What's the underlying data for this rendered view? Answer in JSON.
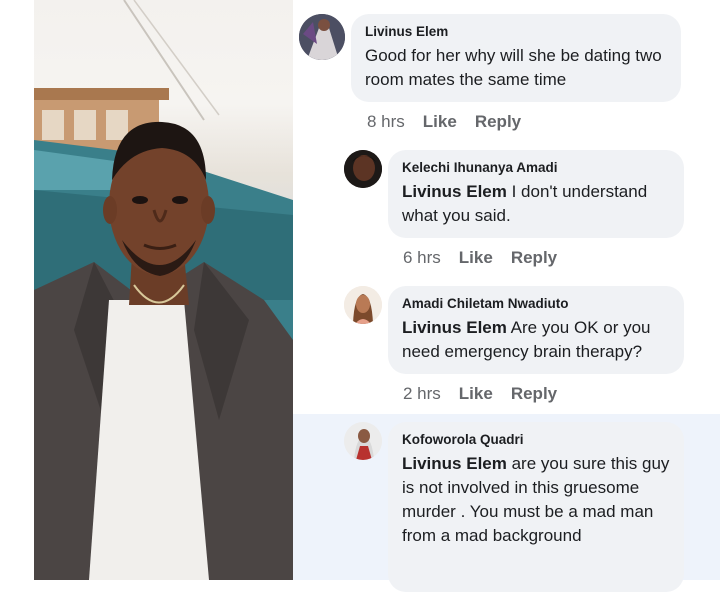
{
  "comments": [
    {
      "name": "Livinus Elem",
      "mention": "",
      "text": "Good for her why will she be dating two room mates the same time",
      "time": "8 hrs",
      "like": "Like",
      "reply": "Reply"
    },
    {
      "name": "Kelechi Ihunanya Amadi",
      "mention": "Livinus Elem",
      "text": " I don't understand what you said.",
      "time": "6 hrs",
      "like": "Like",
      "reply": "Reply"
    },
    {
      "name": "Amadi Chiletam Nwadiuto",
      "mention": "Livinus Elem",
      "text": " Are you OK or you need emergency brain therapy?",
      "time": "2 hrs",
      "like": "Like",
      "reply": "Reply"
    },
    {
      "name": "Kofoworola Quadri",
      "mention": "Livinus Elem",
      "text": " are you sure this guy is not involved in this gruesome murder . You must be a mad man from a mad background",
      "time": "",
      "like": "",
      "reply": ""
    }
  ],
  "colors": {
    "bubble": "#f0f2f5",
    "meta_text": "#65676b",
    "highlight": "#eef3fb",
    "text": "#1c1e21"
  }
}
